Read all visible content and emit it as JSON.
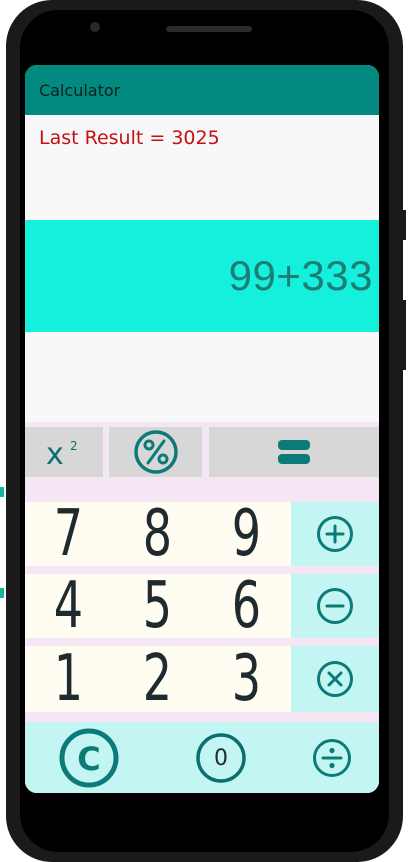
{
  "app": {
    "title": "Calculator"
  },
  "status": {
    "last_result": "Last Result = 3025"
  },
  "display": {
    "expression": "99+333"
  },
  "function_keys": [
    {
      "name": "square",
      "label": "x²"
    },
    {
      "name": "percent",
      "label": "%"
    },
    {
      "name": "equals",
      "label": "="
    }
  ],
  "digits": {
    "row1": [
      "7",
      "8",
      "9"
    ],
    "row2": [
      "4",
      "5",
      "6"
    ],
    "row3": [
      "1",
      "2",
      "3"
    ],
    "zero": "0"
  },
  "operators": [
    "add",
    "subtract",
    "multiply",
    "divide",
    "clear"
  ],
  "colors": {
    "app_bar": "#028a80",
    "display_bg": "#14f0dc",
    "display_text": "#1b7d74",
    "last_result_text": "#c41010",
    "operator_bg": "#c3f6f2",
    "digit_bg": "#fffdf1",
    "function_bg": "#d7d7d7",
    "icon_teal": "#0d7a7a"
  }
}
